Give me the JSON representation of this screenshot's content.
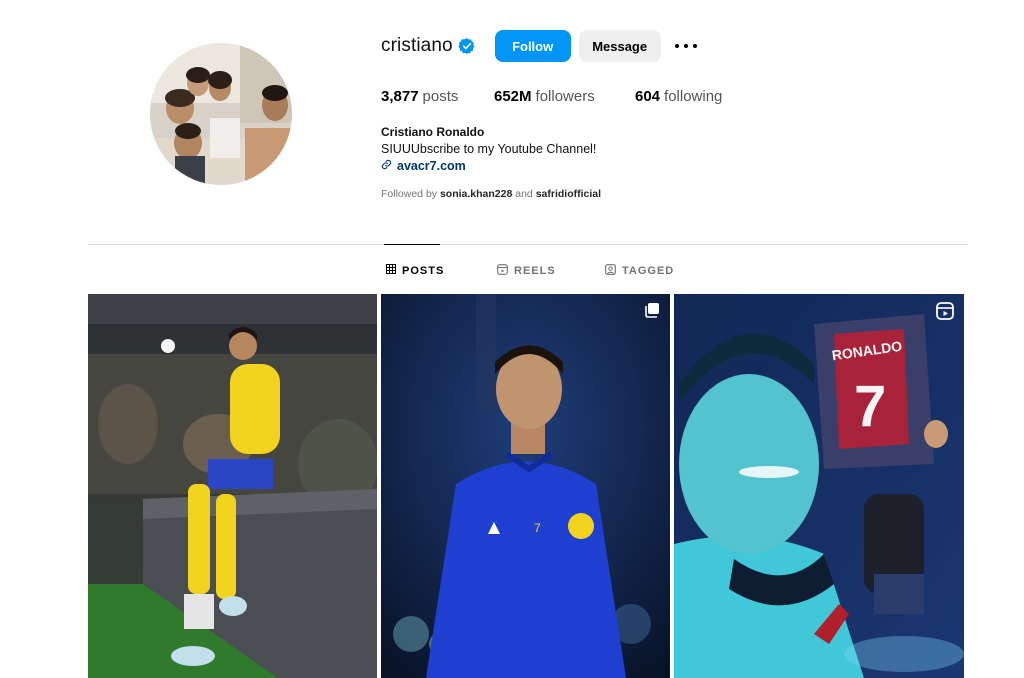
{
  "profile": {
    "username": "cristiano",
    "verified": true,
    "follow_label": "Follow",
    "message_label": "Message",
    "posts_count": "3,877",
    "posts_label": "posts",
    "followers_count": "652M",
    "followers_label": "followers",
    "following_count": "604",
    "following_label": "following",
    "full_name": "Cristiano Ronaldo",
    "bio": "SIUUUbscribe to my Youtube Channel!",
    "link": "avacr7.com",
    "followed_by_prefix": "Followed by",
    "followed_by_user1": "sonia.khan228",
    "followed_by_and": "and",
    "followed_by_user2": "safridiofficial"
  },
  "tabs": [
    {
      "label": "POSTS",
      "icon": "grid-icon",
      "active": true
    },
    {
      "label": "REELS",
      "icon": "reels-icon",
      "active": false
    },
    {
      "label": "TAGGED",
      "icon": "tagged-icon",
      "active": false
    }
  ],
  "grid": [
    {
      "type": "photo",
      "badge": ""
    },
    {
      "type": "carousel",
      "badge": "carousel-icon"
    },
    {
      "type": "reel",
      "badge": "reel-icon",
      "shirt_text": "RONALDO",
      "shirt_number": "7"
    }
  ],
  "colors": {
    "accent": "#0095f6",
    "verified": "#0095f6",
    "link": "#00376b",
    "secondary_text": "#737373"
  }
}
